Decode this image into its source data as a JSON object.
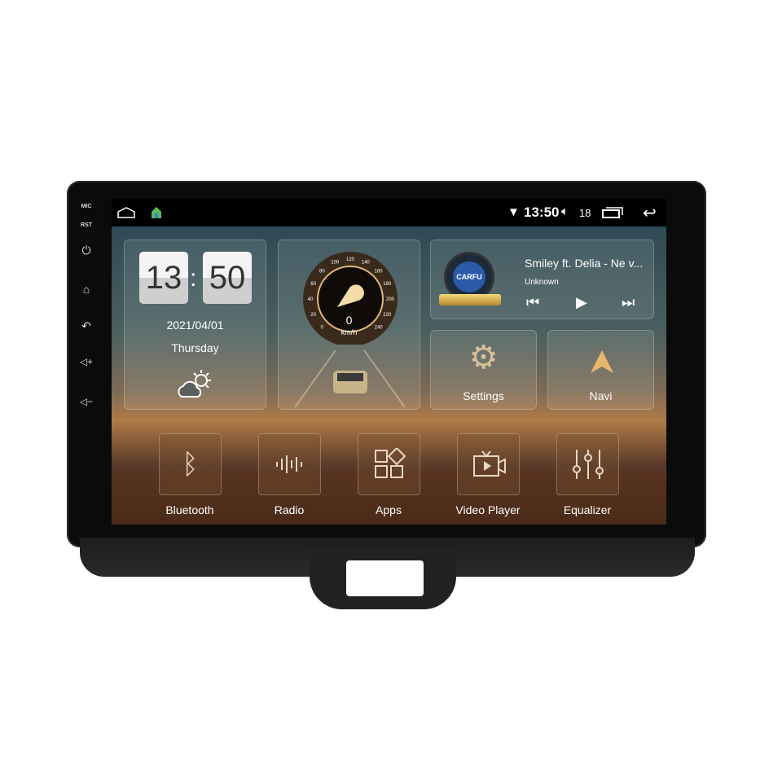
{
  "side": {
    "mic": "MIC",
    "rst": "RST"
  },
  "status": {
    "time": "13:50",
    "volume": "18"
  },
  "clock": {
    "hour": "13",
    "minute": "50",
    "date": "2021/04/01",
    "day": "Thursday",
    "weather": "partly-cloudy-icon"
  },
  "speedo": {
    "value": "0",
    "unit": "km/h",
    "ticks": [
      "0",
      "20",
      "40",
      "60",
      "80",
      "100",
      "120",
      "140",
      "160",
      "180",
      "200",
      "220",
      "240"
    ]
  },
  "music": {
    "logo": "CARFU",
    "title": "Smiley ft. Delia - Ne v...",
    "artist": "Unknown"
  },
  "tiles": {
    "settings": "Settings",
    "navi": "Navi"
  },
  "apps": [
    {
      "label": "Bluetooth"
    },
    {
      "label": "Radio"
    },
    {
      "label": "Apps"
    },
    {
      "label": "Video Player"
    },
    {
      "label": "Equalizer"
    }
  ],
  "colors": {
    "accent": "#d9b27a",
    "bezel": "#0b0b0c"
  }
}
